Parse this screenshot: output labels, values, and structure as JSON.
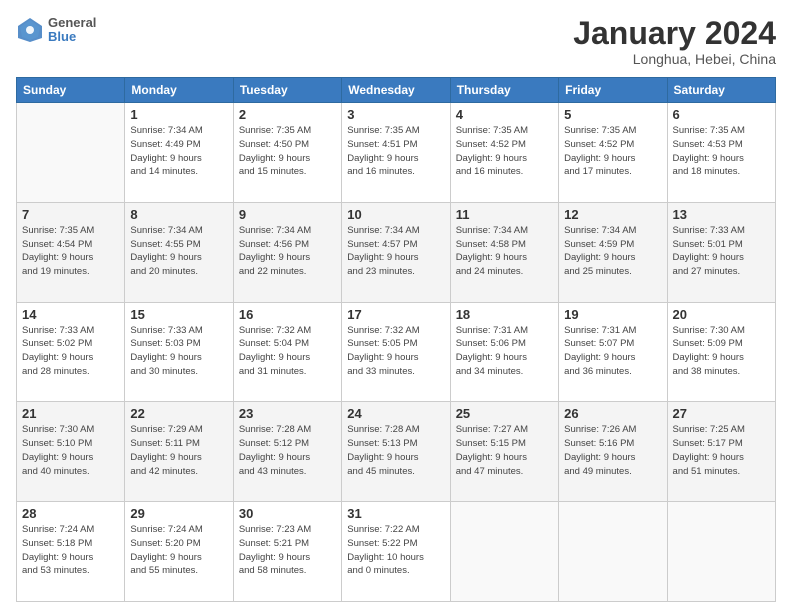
{
  "header": {
    "logo_text_top": "General",
    "logo_text_bottom": "Blue",
    "title": "January 2024",
    "subtitle": "Longhua, Hebei, China"
  },
  "columns": [
    "Sunday",
    "Monday",
    "Tuesday",
    "Wednesday",
    "Thursday",
    "Friday",
    "Saturday"
  ],
  "weeks": [
    {
      "alt": false,
      "days": [
        {
          "num": "",
          "info": ""
        },
        {
          "num": "1",
          "info": "Sunrise: 7:34 AM\nSunset: 4:49 PM\nDaylight: 9 hours\nand 14 minutes."
        },
        {
          "num": "2",
          "info": "Sunrise: 7:35 AM\nSunset: 4:50 PM\nDaylight: 9 hours\nand 15 minutes."
        },
        {
          "num": "3",
          "info": "Sunrise: 7:35 AM\nSunset: 4:51 PM\nDaylight: 9 hours\nand 16 minutes."
        },
        {
          "num": "4",
          "info": "Sunrise: 7:35 AM\nSunset: 4:52 PM\nDaylight: 9 hours\nand 16 minutes."
        },
        {
          "num": "5",
          "info": "Sunrise: 7:35 AM\nSunset: 4:52 PM\nDaylight: 9 hours\nand 17 minutes."
        },
        {
          "num": "6",
          "info": "Sunrise: 7:35 AM\nSunset: 4:53 PM\nDaylight: 9 hours\nand 18 minutes."
        }
      ]
    },
    {
      "alt": true,
      "days": [
        {
          "num": "7",
          "info": "Sunrise: 7:35 AM\nSunset: 4:54 PM\nDaylight: 9 hours\nand 19 minutes."
        },
        {
          "num": "8",
          "info": "Sunrise: 7:34 AM\nSunset: 4:55 PM\nDaylight: 9 hours\nand 20 minutes."
        },
        {
          "num": "9",
          "info": "Sunrise: 7:34 AM\nSunset: 4:56 PM\nDaylight: 9 hours\nand 22 minutes."
        },
        {
          "num": "10",
          "info": "Sunrise: 7:34 AM\nSunset: 4:57 PM\nDaylight: 9 hours\nand 23 minutes."
        },
        {
          "num": "11",
          "info": "Sunrise: 7:34 AM\nSunset: 4:58 PM\nDaylight: 9 hours\nand 24 minutes."
        },
        {
          "num": "12",
          "info": "Sunrise: 7:34 AM\nSunset: 4:59 PM\nDaylight: 9 hours\nand 25 minutes."
        },
        {
          "num": "13",
          "info": "Sunrise: 7:33 AM\nSunset: 5:01 PM\nDaylight: 9 hours\nand 27 minutes."
        }
      ]
    },
    {
      "alt": false,
      "days": [
        {
          "num": "14",
          "info": "Sunrise: 7:33 AM\nSunset: 5:02 PM\nDaylight: 9 hours\nand 28 minutes."
        },
        {
          "num": "15",
          "info": "Sunrise: 7:33 AM\nSunset: 5:03 PM\nDaylight: 9 hours\nand 30 minutes."
        },
        {
          "num": "16",
          "info": "Sunrise: 7:32 AM\nSunset: 5:04 PM\nDaylight: 9 hours\nand 31 minutes."
        },
        {
          "num": "17",
          "info": "Sunrise: 7:32 AM\nSunset: 5:05 PM\nDaylight: 9 hours\nand 33 minutes."
        },
        {
          "num": "18",
          "info": "Sunrise: 7:31 AM\nSunset: 5:06 PM\nDaylight: 9 hours\nand 34 minutes."
        },
        {
          "num": "19",
          "info": "Sunrise: 7:31 AM\nSunset: 5:07 PM\nDaylight: 9 hours\nand 36 minutes."
        },
        {
          "num": "20",
          "info": "Sunrise: 7:30 AM\nSunset: 5:09 PM\nDaylight: 9 hours\nand 38 minutes."
        }
      ]
    },
    {
      "alt": true,
      "days": [
        {
          "num": "21",
          "info": "Sunrise: 7:30 AM\nSunset: 5:10 PM\nDaylight: 9 hours\nand 40 minutes."
        },
        {
          "num": "22",
          "info": "Sunrise: 7:29 AM\nSunset: 5:11 PM\nDaylight: 9 hours\nand 42 minutes."
        },
        {
          "num": "23",
          "info": "Sunrise: 7:28 AM\nSunset: 5:12 PM\nDaylight: 9 hours\nand 43 minutes."
        },
        {
          "num": "24",
          "info": "Sunrise: 7:28 AM\nSunset: 5:13 PM\nDaylight: 9 hours\nand 45 minutes."
        },
        {
          "num": "25",
          "info": "Sunrise: 7:27 AM\nSunset: 5:15 PM\nDaylight: 9 hours\nand 47 minutes."
        },
        {
          "num": "26",
          "info": "Sunrise: 7:26 AM\nSunset: 5:16 PM\nDaylight: 9 hours\nand 49 minutes."
        },
        {
          "num": "27",
          "info": "Sunrise: 7:25 AM\nSunset: 5:17 PM\nDaylight: 9 hours\nand 51 minutes."
        }
      ]
    },
    {
      "alt": false,
      "days": [
        {
          "num": "28",
          "info": "Sunrise: 7:24 AM\nSunset: 5:18 PM\nDaylight: 9 hours\nand 53 minutes."
        },
        {
          "num": "29",
          "info": "Sunrise: 7:24 AM\nSunset: 5:20 PM\nDaylight: 9 hours\nand 55 minutes."
        },
        {
          "num": "30",
          "info": "Sunrise: 7:23 AM\nSunset: 5:21 PM\nDaylight: 9 hours\nand 58 minutes."
        },
        {
          "num": "31",
          "info": "Sunrise: 7:22 AM\nSunset: 5:22 PM\nDaylight: 10 hours\nand 0 minutes."
        },
        {
          "num": "",
          "info": ""
        },
        {
          "num": "",
          "info": ""
        },
        {
          "num": "",
          "info": ""
        }
      ]
    }
  ]
}
